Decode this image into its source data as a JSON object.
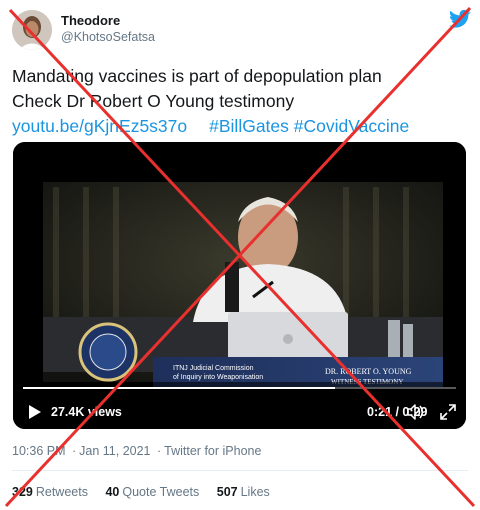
{
  "author": {
    "display_name": "Theodore",
    "handle": "@KhotsoSefatsa"
  },
  "tweet": {
    "line1": "Mandating vaccines is part of depopulation plan",
    "line2": "Check Dr Robert O Young testimony",
    "link_url": "youtu.be/gKjnEz5s37o",
    "hashtag1": "#BillGates",
    "hashtag2": "#CovidVaccine"
  },
  "video": {
    "views": "27.4K views",
    "time": "0:21 / 0:29",
    "progress": 0.72,
    "lower_third_org_line1": "ITNJ Judicial Commission",
    "lower_third_org_line2": "of Inquiry into Weaponisation",
    "lower_third_name": "DR. ROBERT O. YOUNG",
    "lower_third_subtitle": "WITNESS TESTIMONY"
  },
  "meta": {
    "time": "10:36 PM",
    "date": "Jan 11, 2021",
    "source": "Twitter for iPhone"
  },
  "stats": {
    "retweets_count": "329",
    "retweets_label": "Retweets",
    "quote_count": "40",
    "quote_label": "Quote Tweets",
    "likes_count": "507",
    "likes_label": "Likes"
  },
  "colors": {
    "link": "#1b95e0",
    "muted": "#657786",
    "text": "#14171a",
    "cross": "#e8302e"
  },
  "icons": [
    "twitter-bird-icon",
    "play-icon",
    "volume-icon",
    "fullscreen-icon"
  ]
}
